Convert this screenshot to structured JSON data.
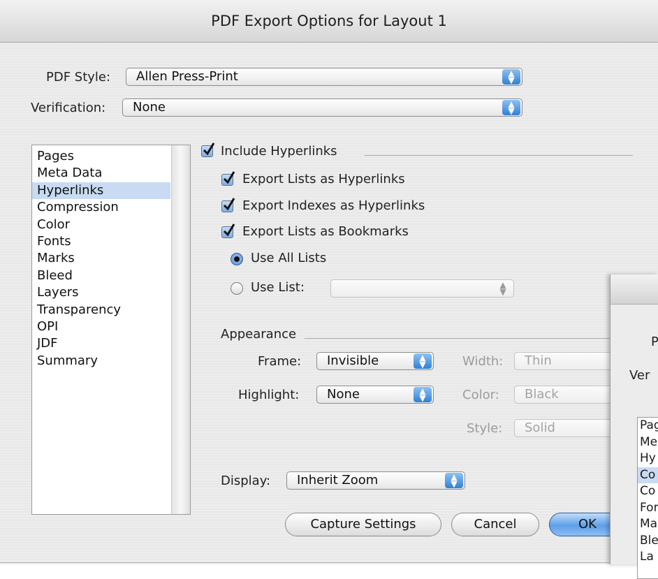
{
  "dialog": {
    "title": "PDF Export Options for Layout 1"
  },
  "pdf_style": {
    "label": "PDF Style:",
    "value": "Allen Press-Print"
  },
  "verification": {
    "label": "Verification:",
    "value": "None"
  },
  "sidebar": {
    "items": [
      "Pages",
      "Meta Data",
      "Hyperlinks",
      "Compression",
      "Color",
      "Fonts",
      "Marks",
      "Bleed",
      "Layers",
      "Transparency",
      "OPI",
      "JDF",
      "Summary"
    ],
    "selected": "Hyperlinks"
  },
  "hyperlinks": {
    "include_hyperlinks": {
      "label": "Include Hyperlinks",
      "checked": true
    },
    "export_lists_as_hyperlinks": {
      "label": "Export Lists as Hyperlinks",
      "checked": true
    },
    "export_indexes_as_hyperlinks": {
      "label": "Export Indexes as Hyperlinks",
      "checked": true
    },
    "export_lists_as_bookmarks": {
      "label": "Export Lists as Bookmarks",
      "checked": true
    },
    "use_all_lists": {
      "label": "Use All Lists",
      "selected": true
    },
    "use_list": {
      "label": "Use List:",
      "selected": false,
      "value": ""
    }
  },
  "appearance": {
    "heading": "Appearance",
    "frame": {
      "label": "Frame:",
      "value": "Invisible"
    },
    "width": {
      "label": "Width:",
      "value": "Thin"
    },
    "highlight": {
      "label": "Highlight:",
      "value": "None"
    },
    "color": {
      "label": "Color:",
      "value": "Black"
    },
    "style": {
      "label": "Style:",
      "value": "Solid"
    }
  },
  "display": {
    "label": "Display:",
    "value": "Inherit Zoom"
  },
  "buttons": {
    "capture": "Capture Settings",
    "cancel": "Cancel",
    "ok": "OK"
  },
  "background_dialog": {
    "labels": [
      "P",
      "Ver"
    ],
    "list_items": [
      "Pag",
      "Me",
      "Hy",
      "Co",
      "Co",
      "For",
      "Ma",
      "Ble",
      "La"
    ],
    "selected_index": 3
  },
  "colors": {
    "accent": "#3a87de",
    "selection": "#c8dbf2"
  },
  "icons": {
    "popup_arrows": "up-down-arrows-icon",
    "checkmark": "checkmark-icon"
  }
}
